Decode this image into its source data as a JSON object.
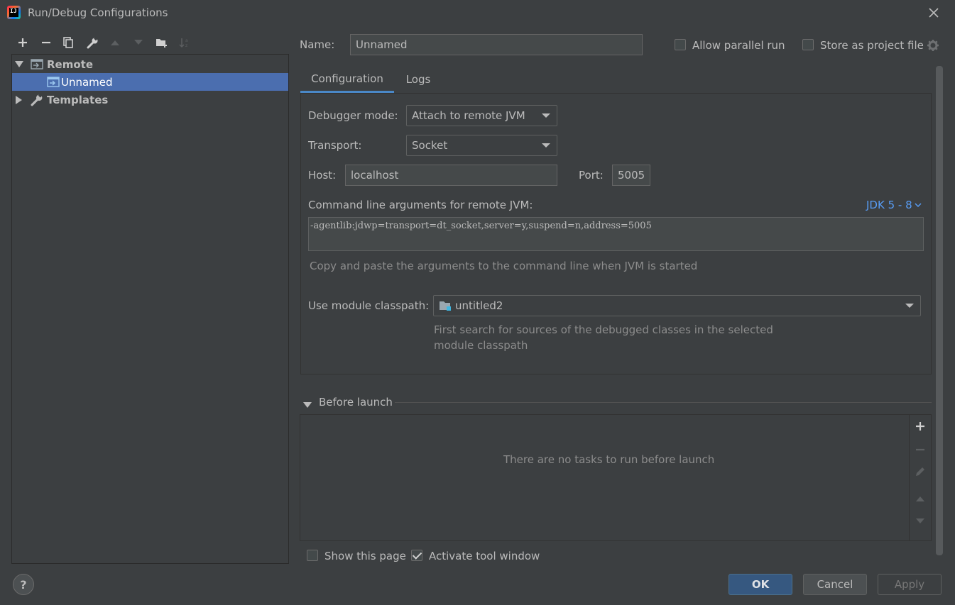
{
  "window": {
    "title": "Run/Debug Configurations",
    "logo_text": "IJ"
  },
  "toolbar": {
    "items": [
      "add-icon",
      "remove-icon",
      "copy-icon",
      "wrench-icon",
      "move-up-icon",
      "move-down-icon",
      "new-folder-icon",
      "sort-icon"
    ]
  },
  "tree": {
    "remote_label": "Remote",
    "unnamed_label": "Unnamed",
    "templates_label": "Templates"
  },
  "header": {
    "name_label": "Name:",
    "name_value": "Unnamed",
    "allow_parallel_label": "Allow parallel run",
    "allow_parallel_checked": false,
    "store_project_label": "Store as project file",
    "store_project_checked": false
  },
  "tabs": {
    "configuration": "Configuration",
    "logs": "Logs",
    "active": "Configuration"
  },
  "config": {
    "debugger_mode_label": "Debugger mode:",
    "debugger_mode_value": "Attach to remote JVM",
    "transport_label": "Transport:",
    "transport_value": "Socket",
    "host_label": "Host:",
    "host_value": "localhost",
    "port_label": "Port:",
    "port_value": "5005",
    "cmdline_label": "Command line arguments for remote JVM:",
    "jdk_link": "JDK 5 - 8",
    "cmdline_value": "-agentlib:jdwp=transport=dt_socket,server=y,suspend=n,address=5005",
    "cmdline_hint": "Copy and paste the arguments to the command line when JVM is started",
    "module_label": "Use module classpath:",
    "module_value": "untitled2",
    "module_hint_line1": "First search for sources of the debugged classes in the selected",
    "module_hint_line2": "module classpath"
  },
  "before_launch": {
    "title": "Before launch",
    "empty_text": "There are no tasks to run before launch"
  },
  "footer": {
    "show_page_label": "Show this page",
    "show_page_checked": false,
    "activate_tool_label": "Activate tool window",
    "activate_tool_checked": true,
    "help_label": "?",
    "ok_label": "OK",
    "cancel_label": "Cancel",
    "apply_label": "Apply"
  },
  "colors": {
    "background": "#3c3f41",
    "selection": "#4b6eaf",
    "accent_link": "#589df6",
    "ok_button": "#365880"
  }
}
